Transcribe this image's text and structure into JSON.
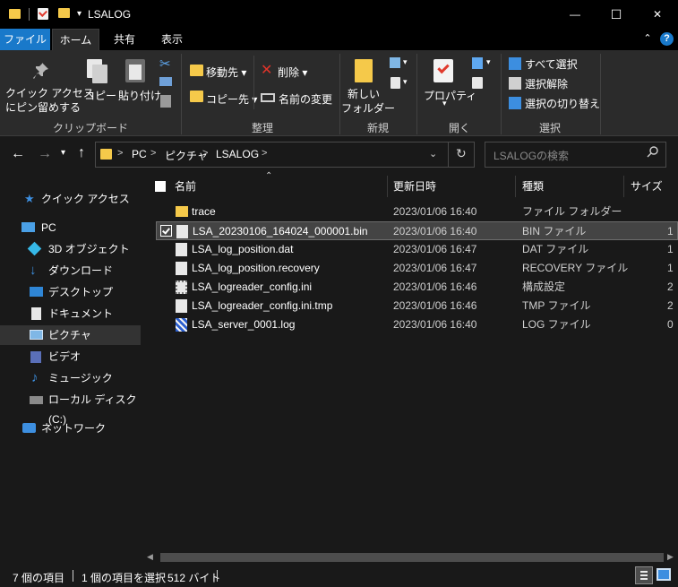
{
  "window": {
    "title": "LSALOG",
    "controls": {
      "minimize": "—",
      "maximize": "☐",
      "close": "✕"
    }
  },
  "ribbon": {
    "tabs": [
      {
        "label": "ファイル",
        "state": "file"
      },
      {
        "label": "ホーム",
        "state": "active"
      },
      {
        "label": "共有",
        "state": "normal"
      },
      {
        "label": "表示",
        "state": "normal"
      }
    ],
    "help_label": "?",
    "collapse_icon": "chevron-up-icon",
    "clipboard": {
      "group_label": "クリップボード",
      "pin_label_1": "クイック アクセス",
      "pin_label_2": "にピン留めする",
      "copy_label": "コピー",
      "paste_label": "貼り付け"
    },
    "organize": {
      "group_label": "整理",
      "move_label": "移動先",
      "copy_to_label": "コピー先",
      "delete_label": "削除",
      "rename_label": "名前の変更"
    },
    "new": {
      "group_label": "新規",
      "new_folder_label_1": "新しい",
      "new_folder_label_2": "フォルダー"
    },
    "open": {
      "group_label": "開く",
      "properties_label": "プロパティ"
    },
    "select": {
      "group_label": "選択",
      "select_all": "すべて選択",
      "select_none": "選択解除",
      "invert": "選択の切り替え"
    }
  },
  "navigation": {
    "path": [
      "PC",
      "ピクチャ",
      "LSALOG"
    ],
    "separator": ">",
    "search_placeholder": "LSALOGの検索"
  },
  "sidebar": {
    "items": [
      {
        "label": "クイック アクセス",
        "icon": "star-icon",
        "color": "#3d8fe0"
      },
      {
        "label": "PC",
        "icon": "computer-icon",
        "color": "#4aa0e6"
      },
      {
        "label": "3D オブジェクト",
        "icon": "cube-icon",
        "color": "#36b9e8"
      },
      {
        "label": "ダウンロード",
        "icon": "download-arrow-icon",
        "color": "#3d8fe0"
      },
      {
        "label": "デスクトップ",
        "icon": "desktop-icon",
        "color": "#2f86d6"
      },
      {
        "label": "ドキュメント",
        "icon": "document-icon",
        "color": "#e8e8e8"
      },
      {
        "label": "ピクチャ",
        "icon": "pictures-icon",
        "color": "#7fb7e6",
        "selected": true
      },
      {
        "label": "ビデオ",
        "icon": "video-icon",
        "color": "#5a6fb8"
      },
      {
        "label": "ミュージック",
        "icon": "music-note-icon",
        "color": "#3d8fe0"
      },
      {
        "label": "ローカル ディスク (C:)",
        "icon": "drive-icon",
        "color": "#8a8a8a"
      },
      {
        "label": "ネットワーク",
        "icon": "network-icon",
        "color": "#3d8fe0"
      }
    ]
  },
  "file_list": {
    "columns": {
      "name": "名前",
      "modified": "更新日時",
      "type": "種類",
      "size": "サイズ"
    },
    "rows": [
      {
        "name": "trace",
        "modified": "2023/01/06 16:40",
        "type": "ファイル フォルダー",
        "size": "",
        "icon": "folder-icon"
      },
      {
        "name": "LSA_20230106_164024_000001.bin",
        "modified": "2023/01/06 16:40",
        "type": "BIN ファイル",
        "size": "1",
        "icon": "file-icon",
        "selected": true
      },
      {
        "name": "LSA_log_position.dat",
        "modified": "2023/01/06 16:47",
        "type": "DAT ファイル",
        "size": "1",
        "icon": "file-icon"
      },
      {
        "name": "LSA_log_position.recovery",
        "modified": "2023/01/06 16:47",
        "type": "RECOVERY ファイル",
        "size": "1",
        "icon": "file-icon"
      },
      {
        "name": "LSA_logreader_config.ini",
        "modified": "2023/01/06 16:46",
        "type": "構成設定",
        "size": "2",
        "icon": "config-file-icon"
      },
      {
        "name": "LSA_logreader_config.ini.tmp",
        "modified": "2023/01/06 16:46",
        "type": "TMP ファイル",
        "size": "2",
        "icon": "file-icon"
      },
      {
        "name": "LSA_server_0001.log",
        "modified": "2023/01/06 16:40",
        "type": "LOG ファイル",
        "size": "0",
        "icon": "log-file-icon"
      }
    ]
  },
  "status_bar": {
    "item_count": "7 個の項目",
    "selection": "1 個の項目を選択",
    "selection_size": "512 バイト"
  }
}
